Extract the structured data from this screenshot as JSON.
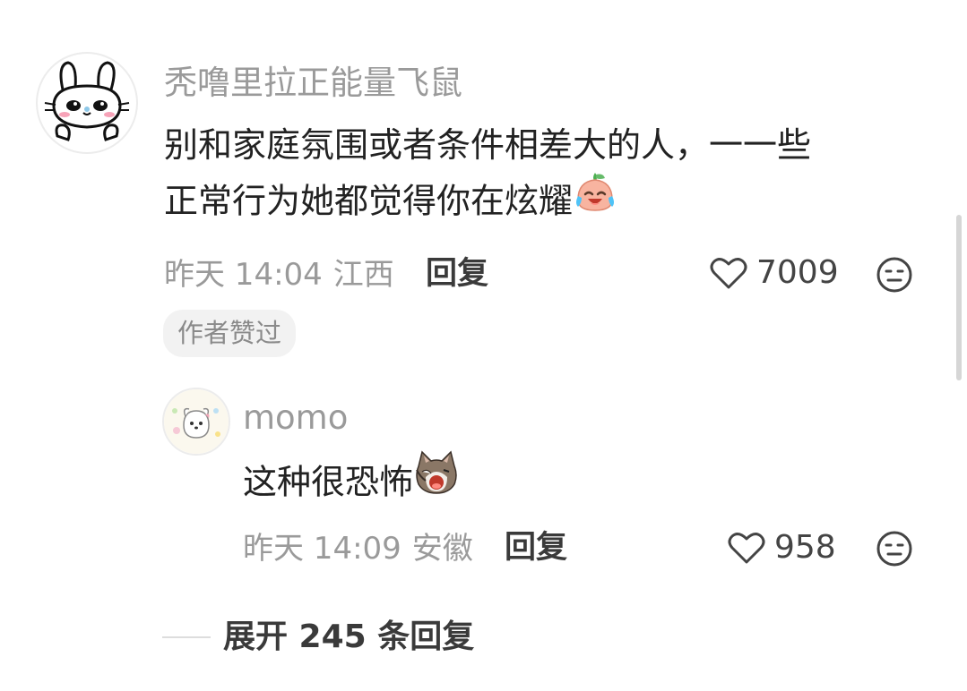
{
  "comment": {
    "username": "秃噜里拉正能量飞鼠",
    "text_line1": "别和家庭氛围或者条件相差大的人，一一些",
    "text_line2": "正常行为她都觉得你在炫耀",
    "emoji": "crying-laughing-peach-emoji",
    "time": "昨天 14:04",
    "location": "江西",
    "reply_label": "回复",
    "likes": "7009",
    "badge": "作者赞过",
    "reply": {
      "username": "momo",
      "text": "这种很恐怖",
      "emoji": "screaming-cat-emoji",
      "time": "昨天 14:09",
      "location": "安徽",
      "reply_label": "回复",
      "likes": "958"
    }
  },
  "expand_replies": "展开 245 条回复",
  "colors": {
    "secondary_text": "#9a9a9a",
    "primary_text": "#222222",
    "badge_bg": "#f2f2f2"
  }
}
